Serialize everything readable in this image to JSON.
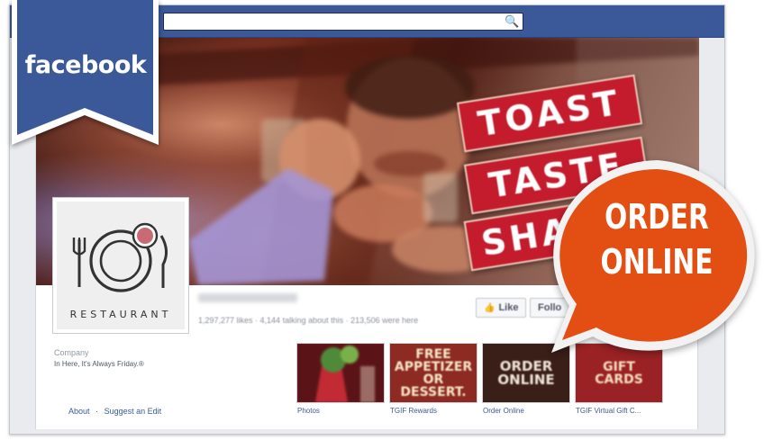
{
  "brand": {
    "ribbon_text": "facebook",
    "ribbon_color": "#3b5998"
  },
  "topbar": {
    "search_placeholder": "",
    "search_icon": "search-icon"
  },
  "cover": {
    "sign_lines": [
      "TOAST",
      "TASTE",
      "SHA"
    ],
    "sign_color": "#b81f2e"
  },
  "profile": {
    "label": "RESTAURANT",
    "icon": "plate-fork-knife-icon"
  },
  "page_info": {
    "stats": "1,297,277 likes · 4,144 talking about this · 213,506 were here",
    "like_label": "Like",
    "follow_label": "Follo"
  },
  "about": {
    "category": "Company",
    "description": "In Here, It's Always Friday.®",
    "links": [
      "About",
      "·",
      "Suggest an Edit"
    ]
  },
  "apps": [
    {
      "tile_text": "",
      "caption": "Photos",
      "bg": "#7a1d22"
    },
    {
      "tile_text": "FREE APPETIZER OR DESSERT.",
      "caption": "TGIF Rewards",
      "bg": "#8d2a22"
    },
    {
      "tile_text": "ORDER ONLINE",
      "caption": "Order Online",
      "bg": "#3a1e18"
    },
    {
      "tile_text": "GIFT CARDS",
      "caption": "TGIF Virtual Gift C...",
      "bg": "#9a2224"
    }
  ],
  "callout": {
    "line1": "ORDER",
    "line2": "ONLINE",
    "color": "#e34f12"
  }
}
